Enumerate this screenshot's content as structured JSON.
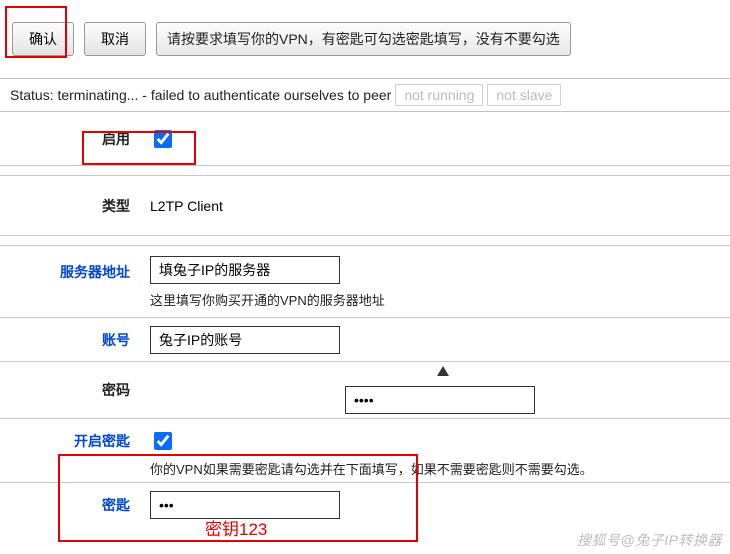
{
  "toolbar": {
    "confirm": "确认",
    "cancel": "取消",
    "tip": "请按要求填写你的VPN，有密匙可勾选密匙填写，没有不要勾选"
  },
  "status": {
    "main": "Status: terminating... - failed to authenticate ourselves to peer",
    "chip1": "not running",
    "chip2": "not slave"
  },
  "form": {
    "enable_label": "启用",
    "enable_checked": true,
    "type_label": "类型",
    "type_value": "L2TP Client",
    "server_label": "服务器地址",
    "server_value": "填兔子IP的服务器",
    "server_hint": "这里填写你购买开通的VPN的服务器地址",
    "account_label": "账号",
    "account_value": "兔子IP的账号",
    "password_label": "密码",
    "password_value": "••••",
    "open_key_label": "开启密匙",
    "open_key_checked": true,
    "open_key_hint": "你的VPN如果需要密匙请勾选并在下面填写，如果不需要密匙则不需要勾选。",
    "key_label": "密匙",
    "key_value": "•••",
    "key_overlay": "密钥123"
  },
  "watermark": "搜狐号@兔子IP转换器"
}
